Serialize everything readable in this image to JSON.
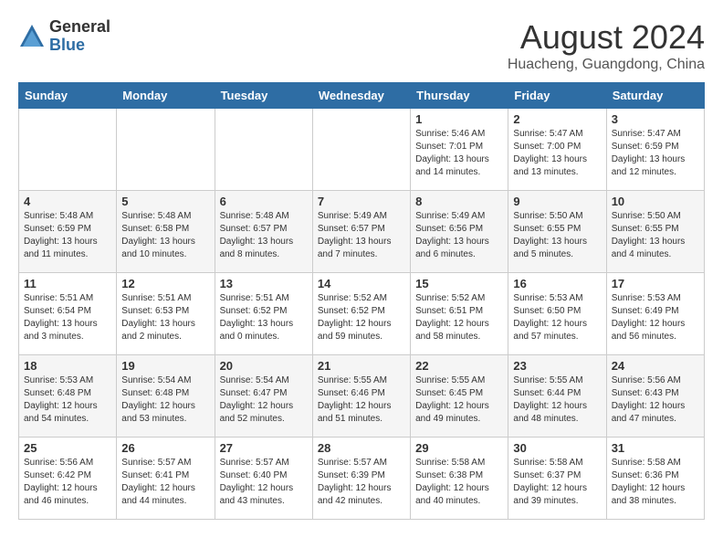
{
  "logo": {
    "general": "General",
    "blue": "Blue"
  },
  "title": "August 2024",
  "subtitle": "Huacheng, Guangdong, China",
  "days_of_week": [
    "Sunday",
    "Monday",
    "Tuesday",
    "Wednesday",
    "Thursday",
    "Friday",
    "Saturday"
  ],
  "weeks": [
    [
      {
        "day": "",
        "info": ""
      },
      {
        "day": "",
        "info": ""
      },
      {
        "day": "",
        "info": ""
      },
      {
        "day": "",
        "info": ""
      },
      {
        "day": "1",
        "info": "Sunrise: 5:46 AM\nSunset: 7:01 PM\nDaylight: 13 hours\nand 14 minutes."
      },
      {
        "day": "2",
        "info": "Sunrise: 5:47 AM\nSunset: 7:00 PM\nDaylight: 13 hours\nand 13 minutes."
      },
      {
        "day": "3",
        "info": "Sunrise: 5:47 AM\nSunset: 6:59 PM\nDaylight: 13 hours\nand 12 minutes."
      }
    ],
    [
      {
        "day": "4",
        "info": "Sunrise: 5:48 AM\nSunset: 6:59 PM\nDaylight: 13 hours\nand 11 minutes."
      },
      {
        "day": "5",
        "info": "Sunrise: 5:48 AM\nSunset: 6:58 PM\nDaylight: 13 hours\nand 10 minutes."
      },
      {
        "day": "6",
        "info": "Sunrise: 5:48 AM\nSunset: 6:57 PM\nDaylight: 13 hours\nand 8 minutes."
      },
      {
        "day": "7",
        "info": "Sunrise: 5:49 AM\nSunset: 6:57 PM\nDaylight: 13 hours\nand 7 minutes."
      },
      {
        "day": "8",
        "info": "Sunrise: 5:49 AM\nSunset: 6:56 PM\nDaylight: 13 hours\nand 6 minutes."
      },
      {
        "day": "9",
        "info": "Sunrise: 5:50 AM\nSunset: 6:55 PM\nDaylight: 13 hours\nand 5 minutes."
      },
      {
        "day": "10",
        "info": "Sunrise: 5:50 AM\nSunset: 6:55 PM\nDaylight: 13 hours\nand 4 minutes."
      }
    ],
    [
      {
        "day": "11",
        "info": "Sunrise: 5:51 AM\nSunset: 6:54 PM\nDaylight: 13 hours\nand 3 minutes."
      },
      {
        "day": "12",
        "info": "Sunrise: 5:51 AM\nSunset: 6:53 PM\nDaylight: 13 hours\nand 2 minutes."
      },
      {
        "day": "13",
        "info": "Sunrise: 5:51 AM\nSunset: 6:52 PM\nDaylight: 13 hours\nand 0 minutes."
      },
      {
        "day": "14",
        "info": "Sunrise: 5:52 AM\nSunset: 6:52 PM\nDaylight: 12 hours\nand 59 minutes."
      },
      {
        "day": "15",
        "info": "Sunrise: 5:52 AM\nSunset: 6:51 PM\nDaylight: 12 hours\nand 58 minutes."
      },
      {
        "day": "16",
        "info": "Sunrise: 5:53 AM\nSunset: 6:50 PM\nDaylight: 12 hours\nand 57 minutes."
      },
      {
        "day": "17",
        "info": "Sunrise: 5:53 AM\nSunset: 6:49 PM\nDaylight: 12 hours\nand 56 minutes."
      }
    ],
    [
      {
        "day": "18",
        "info": "Sunrise: 5:53 AM\nSunset: 6:48 PM\nDaylight: 12 hours\nand 54 minutes."
      },
      {
        "day": "19",
        "info": "Sunrise: 5:54 AM\nSunset: 6:48 PM\nDaylight: 12 hours\nand 53 minutes."
      },
      {
        "day": "20",
        "info": "Sunrise: 5:54 AM\nSunset: 6:47 PM\nDaylight: 12 hours\nand 52 minutes."
      },
      {
        "day": "21",
        "info": "Sunrise: 5:55 AM\nSunset: 6:46 PM\nDaylight: 12 hours\nand 51 minutes."
      },
      {
        "day": "22",
        "info": "Sunrise: 5:55 AM\nSunset: 6:45 PM\nDaylight: 12 hours\nand 49 minutes."
      },
      {
        "day": "23",
        "info": "Sunrise: 5:55 AM\nSunset: 6:44 PM\nDaylight: 12 hours\nand 48 minutes."
      },
      {
        "day": "24",
        "info": "Sunrise: 5:56 AM\nSunset: 6:43 PM\nDaylight: 12 hours\nand 47 minutes."
      }
    ],
    [
      {
        "day": "25",
        "info": "Sunrise: 5:56 AM\nSunset: 6:42 PM\nDaylight: 12 hours\nand 46 minutes."
      },
      {
        "day": "26",
        "info": "Sunrise: 5:57 AM\nSunset: 6:41 PM\nDaylight: 12 hours\nand 44 minutes."
      },
      {
        "day": "27",
        "info": "Sunrise: 5:57 AM\nSunset: 6:40 PM\nDaylight: 12 hours\nand 43 minutes."
      },
      {
        "day": "28",
        "info": "Sunrise: 5:57 AM\nSunset: 6:39 PM\nDaylight: 12 hours\nand 42 minutes."
      },
      {
        "day": "29",
        "info": "Sunrise: 5:58 AM\nSunset: 6:38 PM\nDaylight: 12 hours\nand 40 minutes."
      },
      {
        "day": "30",
        "info": "Sunrise: 5:58 AM\nSunset: 6:37 PM\nDaylight: 12 hours\nand 39 minutes."
      },
      {
        "day": "31",
        "info": "Sunrise: 5:58 AM\nSunset: 6:36 PM\nDaylight: 12 hours\nand 38 minutes."
      }
    ]
  ]
}
